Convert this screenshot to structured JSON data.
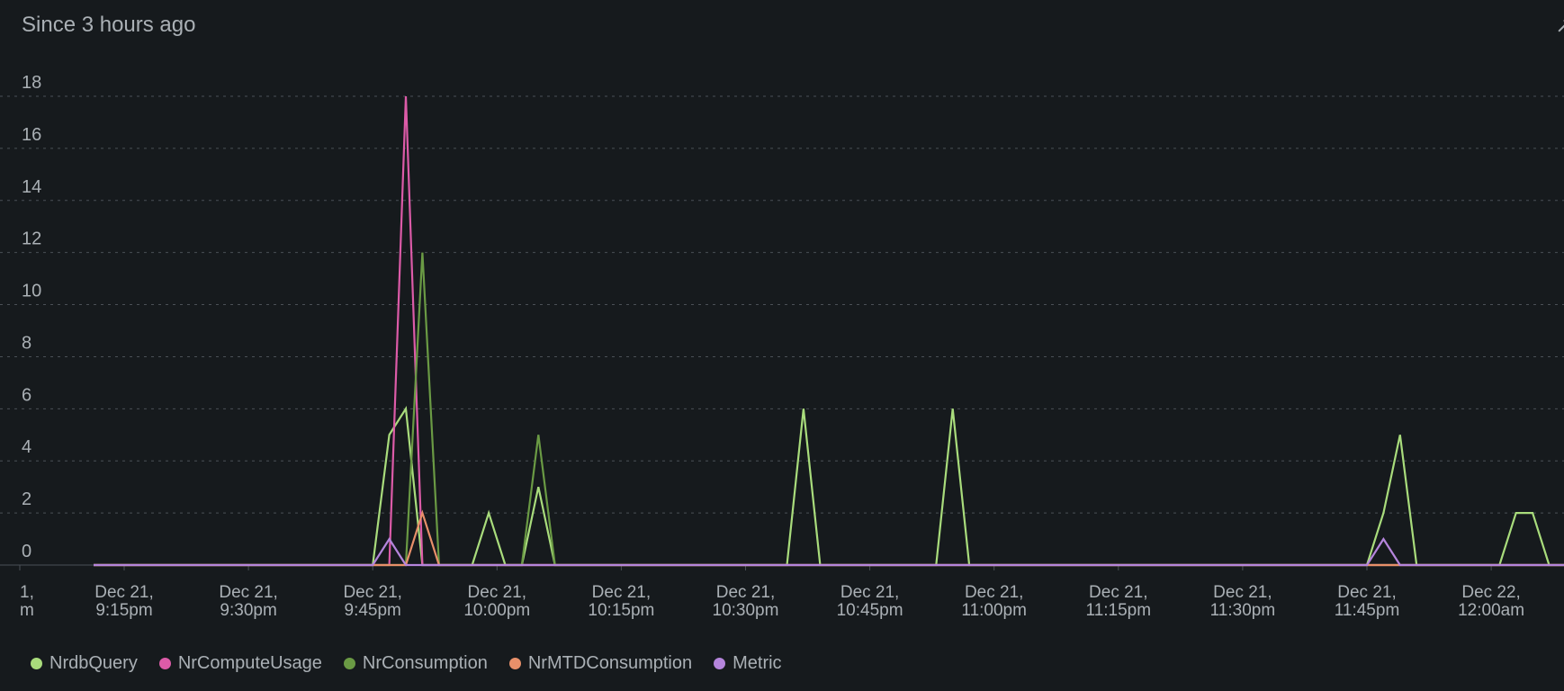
{
  "header": {
    "title": "Since 3 hours ago",
    "corner_glyph": "↗"
  },
  "chart_data": {
    "type": "line",
    "title": "Since 3 hours ago",
    "xlabel": "",
    "ylabel": "",
    "ylim": [
      0,
      18
    ],
    "yticks": [
      0,
      2,
      4,
      6,
      8,
      10,
      12,
      14,
      16,
      18
    ],
    "grid": true,
    "legend_position": "bottom-left",
    "x_unit": "minutes since Dec 21, 9:00pm",
    "x_range": [
      -5,
      180
    ],
    "xticks": [
      {
        "x": 0,
        "line1": "1,",
        "line2": "m"
      },
      {
        "x": 15,
        "line1": "Dec 21,",
        "line2": "9:15pm"
      },
      {
        "x": 30,
        "line1": "Dec 21,",
        "line2": "9:30pm"
      },
      {
        "x": 45,
        "line1": "Dec 21,",
        "line2": "9:45pm"
      },
      {
        "x": 60,
        "line1": "Dec 21,",
        "line2": "10:00pm"
      },
      {
        "x": 75,
        "line1": "Dec 21,",
        "line2": "10:15pm"
      },
      {
        "x": 90,
        "line1": "Dec 21,",
        "line2": "10:30pm"
      },
      {
        "x": 105,
        "line1": "Dec 21,",
        "line2": "10:45pm"
      },
      {
        "x": 120,
        "line1": "Dec 21,",
        "line2": "11:00pm"
      },
      {
        "x": 135,
        "line1": "Dec 21,",
        "line2": "11:15pm"
      },
      {
        "x": 150,
        "line1": "Dec 21,",
        "line2": "11:30pm"
      },
      {
        "x": 165,
        "line1": "Dec 21,",
        "line2": "11:45pm"
      },
      {
        "x": 180,
        "line1": "Dec 22,",
        "line2": "12:00am"
      }
    ],
    "series": [
      {
        "name": "NrdbQuery",
        "color": "#a9dc7c",
        "points": [
          [
            4,
            0
          ],
          [
            45,
            0
          ],
          [
            47,
            5
          ],
          [
            49,
            6
          ],
          [
            51,
            0
          ],
          [
            57,
            0
          ],
          [
            59,
            2
          ],
          [
            61,
            0
          ],
          [
            63,
            0
          ],
          [
            65,
            3
          ],
          [
            67,
            0
          ],
          [
            95,
            0
          ],
          [
            97,
            6
          ],
          [
            99,
            0
          ],
          [
            113,
            0
          ],
          [
            115,
            6
          ],
          [
            117,
            0
          ],
          [
            165,
            0
          ],
          [
            167,
            2
          ],
          [
            169,
            5
          ],
          [
            171,
            0
          ],
          [
            181,
            0
          ],
          [
            183,
            2
          ],
          [
            185,
            2
          ],
          [
            187,
            0
          ],
          [
            189,
            0
          ]
        ]
      },
      {
        "name": "NrComputeUsage",
        "color": "#dc5ba8",
        "points": [
          [
            4,
            0
          ],
          [
            47,
            0
          ],
          [
            49,
            18
          ],
          [
            51,
            0
          ],
          [
            189,
            0
          ]
        ]
      },
      {
        "name": "NrConsumption",
        "color": "#6a9a44",
        "points": [
          [
            4,
            0
          ],
          [
            49,
            0
          ],
          [
            51,
            12
          ],
          [
            53,
            0
          ],
          [
            63,
            0
          ],
          [
            65,
            5
          ],
          [
            67,
            0
          ],
          [
            189,
            0
          ]
        ]
      },
      {
        "name": "NrMTDConsumption",
        "color": "#e8906a",
        "points": [
          [
            4,
            0
          ],
          [
            49,
            0
          ],
          [
            51,
            2
          ],
          [
            53,
            0
          ],
          [
            189,
            0
          ]
        ]
      },
      {
        "name": "Metric",
        "color": "#b585dc",
        "points": [
          [
            4,
            0
          ],
          [
            45,
            0
          ],
          [
            47,
            1
          ],
          [
            49,
            0
          ],
          [
            165,
            0
          ],
          [
            167,
            1
          ],
          [
            169,
            0
          ],
          [
            189,
            0
          ]
        ]
      }
    ]
  }
}
